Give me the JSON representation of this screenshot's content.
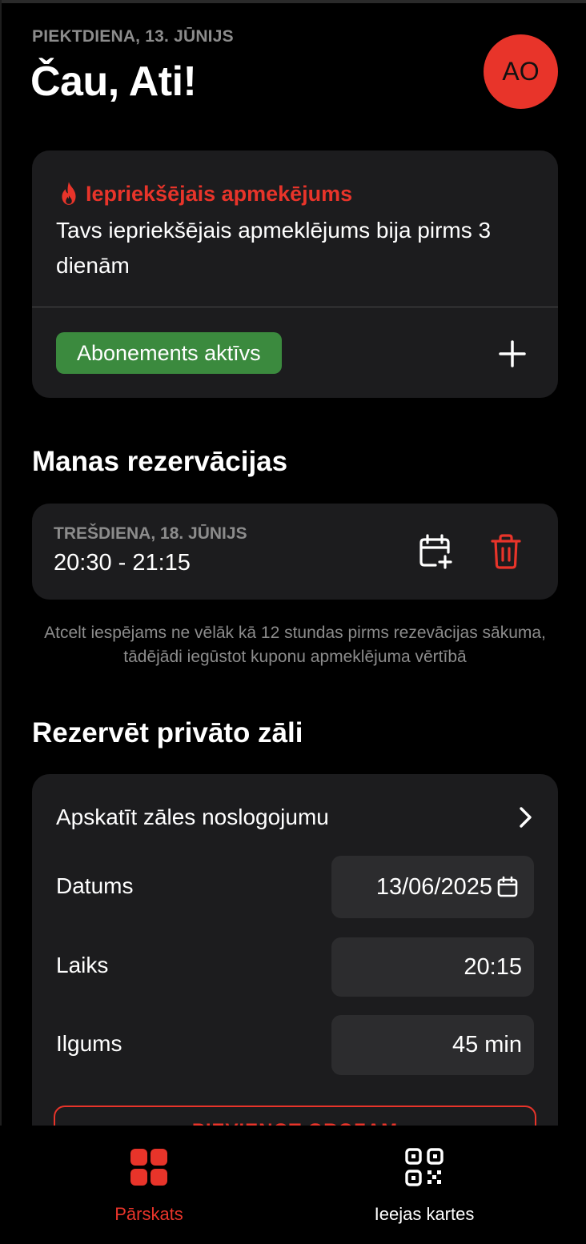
{
  "header": {
    "date": "PIEKTDIENA, 13. JŪNIJS",
    "greeting": "Čau, Ati!",
    "avatar_initials": "AO"
  },
  "last_visit": {
    "icon": "flame-icon",
    "title": "Iepriekšējais apmekējums",
    "text": "Tavs iepriekšējais apmeklējums bija pirms 3 dienām",
    "subscription_badge": "Abonements aktīvs",
    "add_icon": "plus-icon"
  },
  "reservations": {
    "section_title": "Manas rezervācijas",
    "items": [
      {
        "date": "TREŠDIENA, 18. JŪNIJS",
        "time": "20:30 - 21:15"
      }
    ],
    "cancel_note": "Atcelt iespējams ne vēlāk kā 12 stundas pirms rezevācijas sākuma, tādējādi iegūstot kuponu apmeklējuma vērtībā"
  },
  "booking": {
    "section_title": "Rezervēt privāto zāli",
    "view_occupancy": "Apskatīt zāles noslogojumu",
    "date_label": "Datums",
    "date_value": "13/06/2025",
    "time_label": "Laiks",
    "time_value": "20:15",
    "duration_label": "Ilgums",
    "duration_value": "45 min",
    "add_to_cart": "PIEVIENOT GROZAM"
  },
  "nav": {
    "overview_label": "Pārskats",
    "cards_label": "Ieejas kartes"
  },
  "colors": {
    "accent": "#e8342a",
    "success": "#3b8a3e",
    "card_bg": "#1c1c1e",
    "field_bg": "#2c2c2e",
    "muted": "#8c8c8c"
  }
}
